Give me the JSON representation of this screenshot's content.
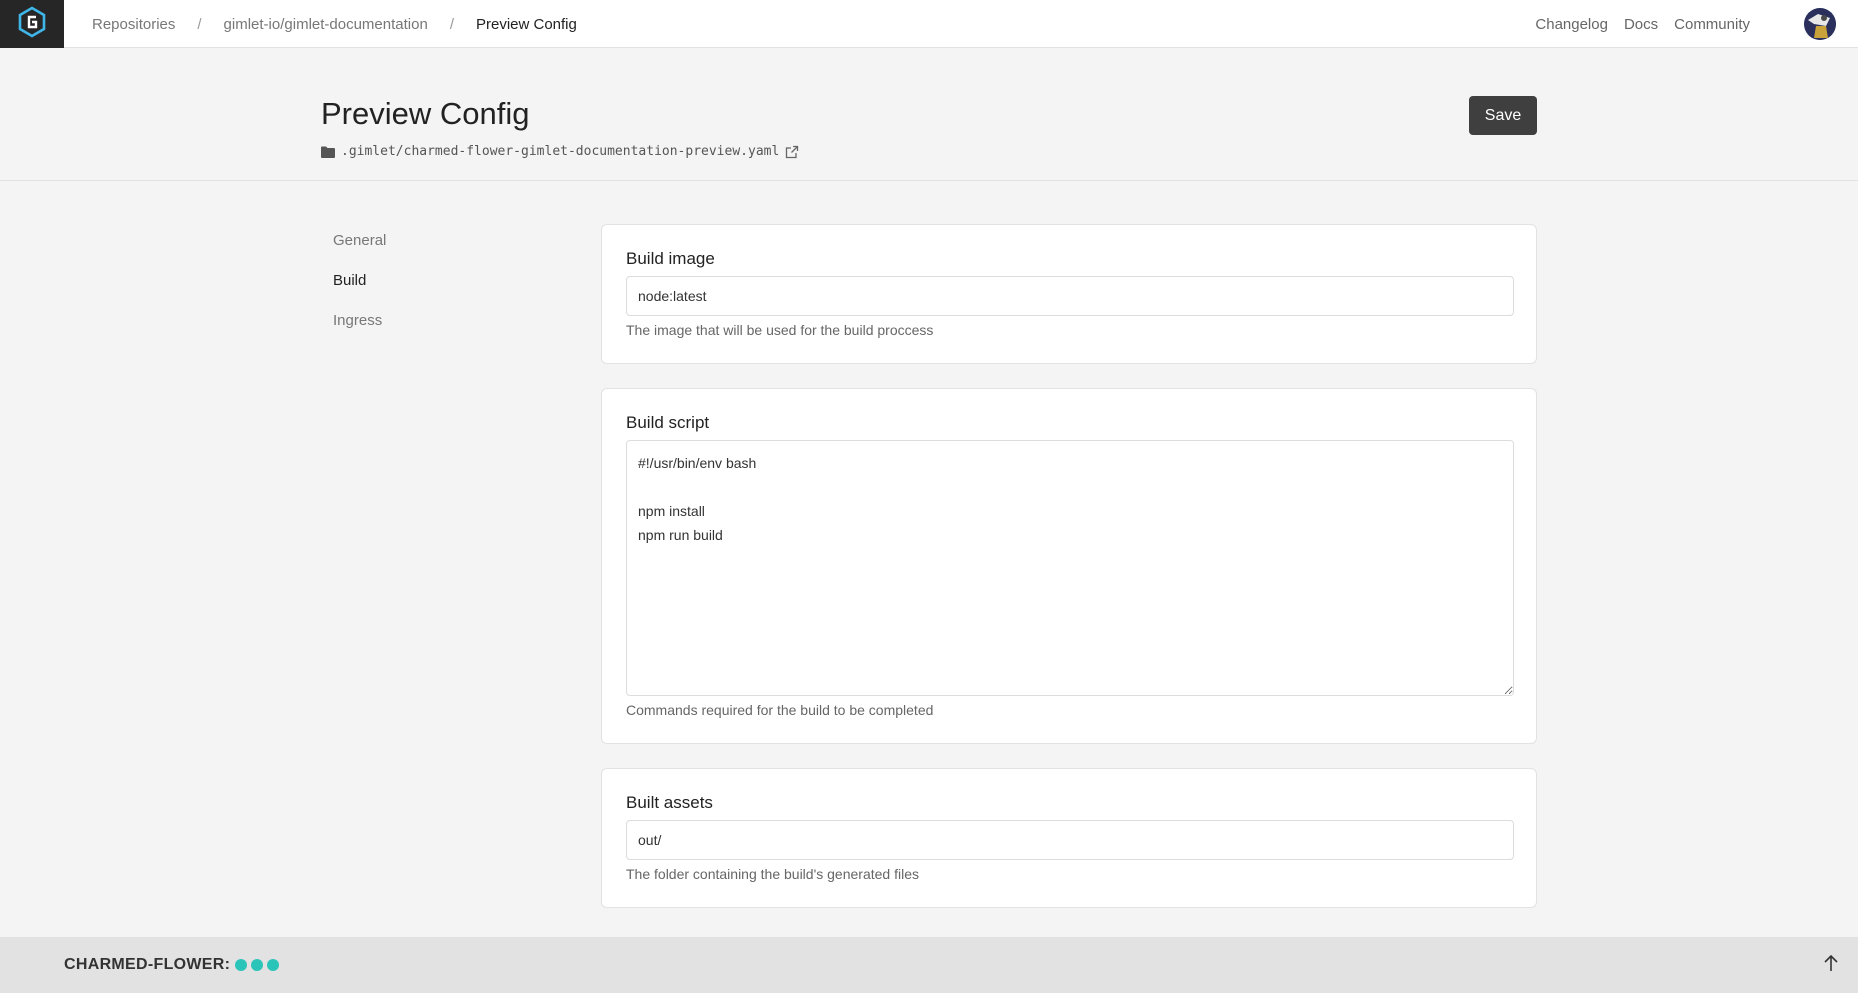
{
  "breadcrumb": {
    "items": [
      "Repositories",
      "gimlet-io/gimlet-documentation",
      "Preview Config"
    ],
    "separator": "/"
  },
  "topnav": {
    "changelog": "Changelog",
    "docs": "Docs",
    "community": "Community"
  },
  "header": {
    "title": "Preview Config",
    "file_path": ".gimlet/charmed-flower-gimlet-documentation-preview.yaml",
    "save_label": "Save"
  },
  "sidenav": {
    "items": [
      "General",
      "Build",
      "Ingress"
    ],
    "active": "Build"
  },
  "build_image": {
    "title": "Build image",
    "value": "node:latest",
    "help": "The image that will be used for the build proccess"
  },
  "build_script": {
    "title": "Build script",
    "value": "#!/usr/bin/env bash\n\nnpm install\nnpm run build",
    "help": "Commands required for the build to be completed"
  },
  "built_assets": {
    "title": "Built assets",
    "value": "out/",
    "help": "The folder containing the build's generated files"
  },
  "footer": {
    "env_label": "CHARMED-FLOWER:",
    "status_dots": 3,
    "dot_color": "#2bc4b8"
  },
  "icons": {
    "logo": "gimlet-logo-icon",
    "folder": "folder-icon",
    "external_link": "external-link-icon",
    "scroll_top": "arrow-up-icon"
  },
  "colors": {
    "topbar_logo_bg": "#262626",
    "save_button_bg": "#3f3f3f",
    "accent_teal": "#2bc4b8"
  }
}
